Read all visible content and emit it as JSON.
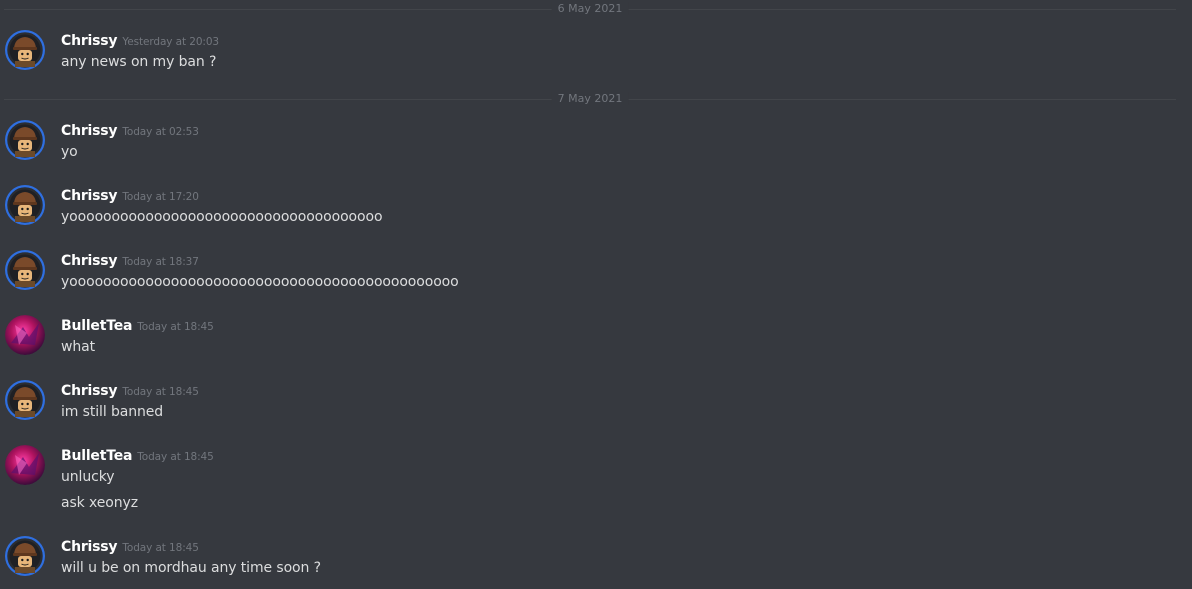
{
  "dividers": [
    {
      "label": "6 May 2021"
    },
    {
      "label": "7 May 2021"
    }
  ],
  "messages": [
    {
      "author": "Chrissy",
      "timestamp": "Yesterday at 20:03",
      "avatar": "lego-minifig-avatar",
      "lines": [
        "any news on my ban ?"
      ]
    },
    {
      "author": "Chrissy",
      "timestamp": "Today at 02:53",
      "avatar": "lego-minifig-avatar",
      "lines": [
        "yo"
      ]
    },
    {
      "author": "Chrissy",
      "timestamp": "Today at 17:20",
      "avatar": "lego-minifig-avatar",
      "lines": [
        "yooooooooooooooooooooooooooooooooooooo"
      ]
    },
    {
      "author": "Chrissy",
      "timestamp": "Today at 18:37",
      "avatar": "lego-minifig-avatar",
      "lines": [
        "yoooooooooooooooooooooooooooooooooooooooooooooo"
      ]
    },
    {
      "author": "BulletTea",
      "timestamp": "Today at 18:45",
      "avatar": "abstract-magenta-avatar",
      "lines": [
        "what"
      ]
    },
    {
      "author": "Chrissy",
      "timestamp": "Today at 18:45",
      "avatar": "lego-minifig-avatar",
      "lines": [
        "im still banned"
      ]
    },
    {
      "author": "BulletTea",
      "timestamp": "Today at 18:45",
      "avatar": "abstract-magenta-avatar",
      "lines": [
        "unlucky",
        "ask xeonyz"
      ]
    },
    {
      "author": "Chrissy",
      "timestamp": "Today at 18:45",
      "avatar": "lego-minifig-avatar",
      "lines": [
        "will u be on mordhau any time soon ?"
      ]
    }
  ],
  "colors": {
    "background": "#36393f",
    "username": "#ffffff",
    "timestamp": "#72767d",
    "message_text": "#dcddde",
    "divider": "#42454a",
    "avatar_ring": "#2f6fe0"
  }
}
